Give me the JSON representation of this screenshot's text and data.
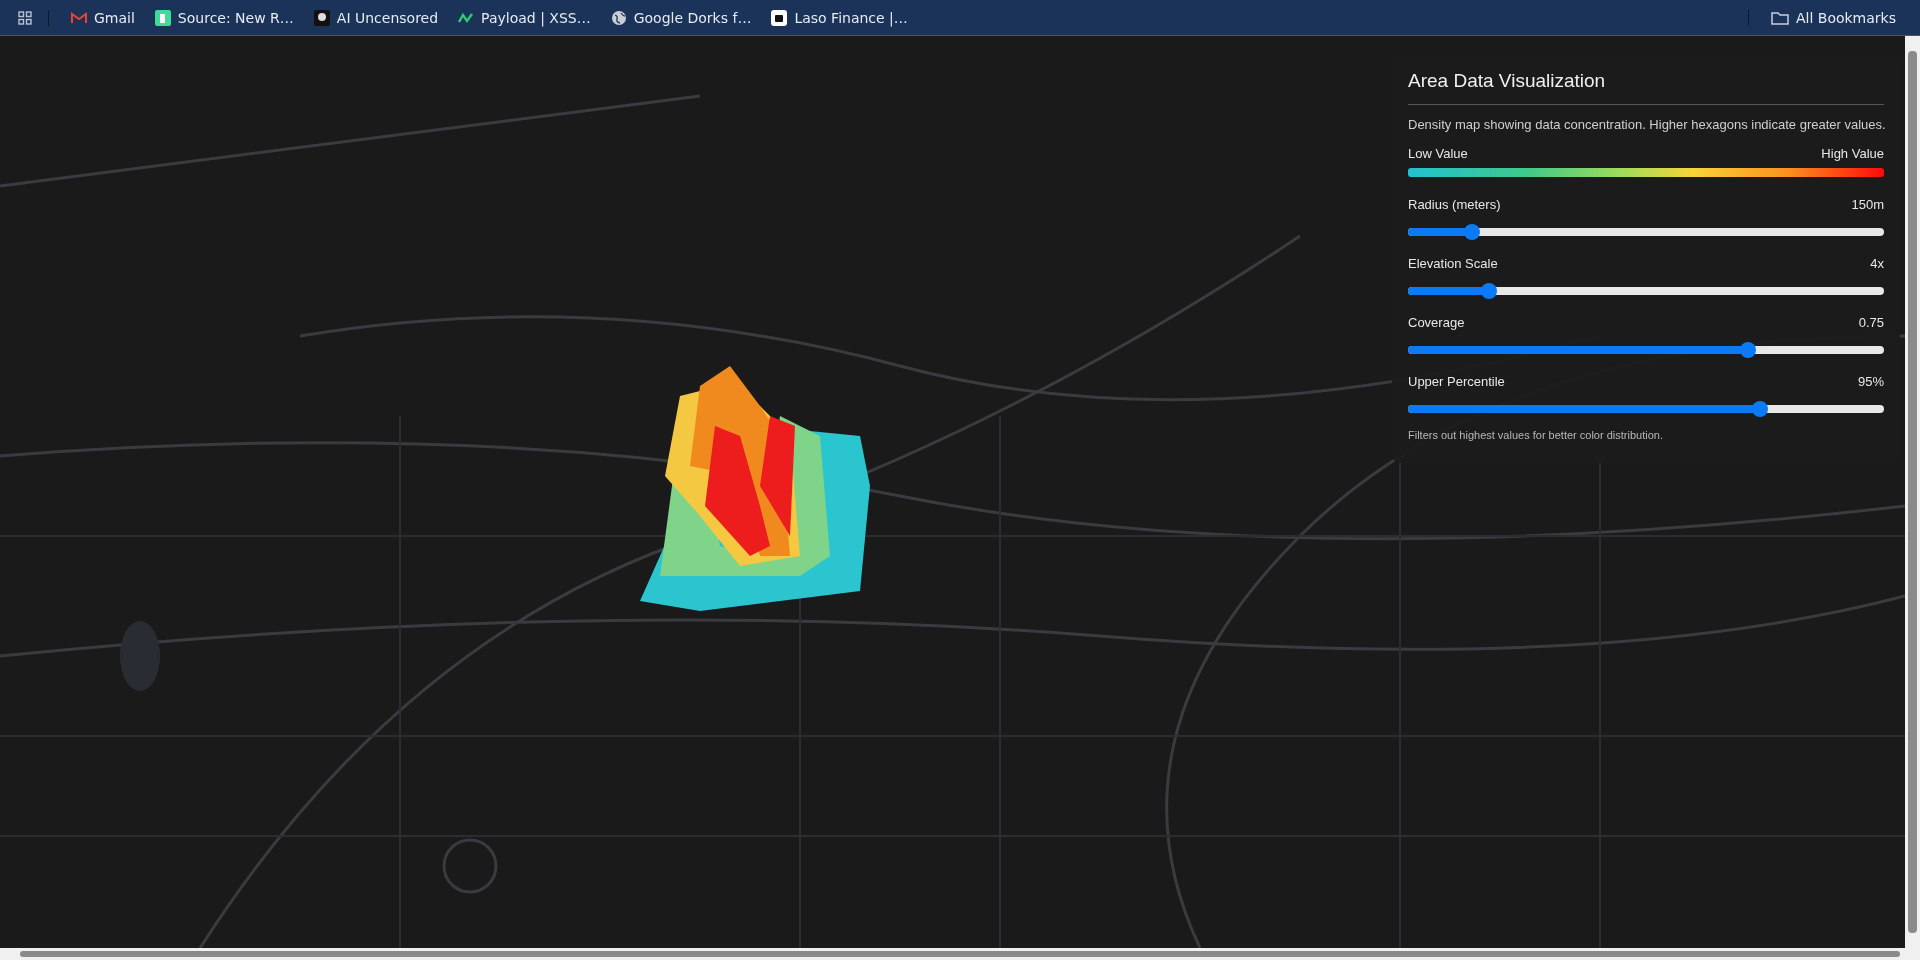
{
  "bookmarks_bar": {
    "bookmarks": [
      {
        "kind": "mail",
        "label": "Gmail"
      },
      {
        "kind": "tile",
        "label": "Source: New R…"
      },
      {
        "kind": "mono",
        "label": "AI Uncensored"
      },
      {
        "kind": "zigzag",
        "label": "Payload | XSS…"
      },
      {
        "kind": "globe",
        "label": "Google Dorks f…"
      },
      {
        "kind": "square",
        "label": "Laso Finance |…"
      }
    ],
    "all_bookmarks": "All Bookmarks"
  },
  "panel": {
    "title": "Area Data Visualization",
    "description": "Density map showing data concentration. Higher hexagons indicate greater values.",
    "legend": {
      "low": "Low Value",
      "high": "High Value"
    },
    "sliders": [
      {
        "label": "Radius (meters)",
        "reading": "150m",
        "level": 0.135
      },
      {
        "label": "Elevation Scale",
        "reading": "4x",
        "level": 0.17
      },
      {
        "label": "Coverage",
        "reading": "0.75",
        "level": 0.715
      },
      {
        "label": "Upper Percentile",
        "reading": "95%",
        "level": 0.74
      }
    ],
    "note": "Filters out highest values for better color distribution."
  }
}
